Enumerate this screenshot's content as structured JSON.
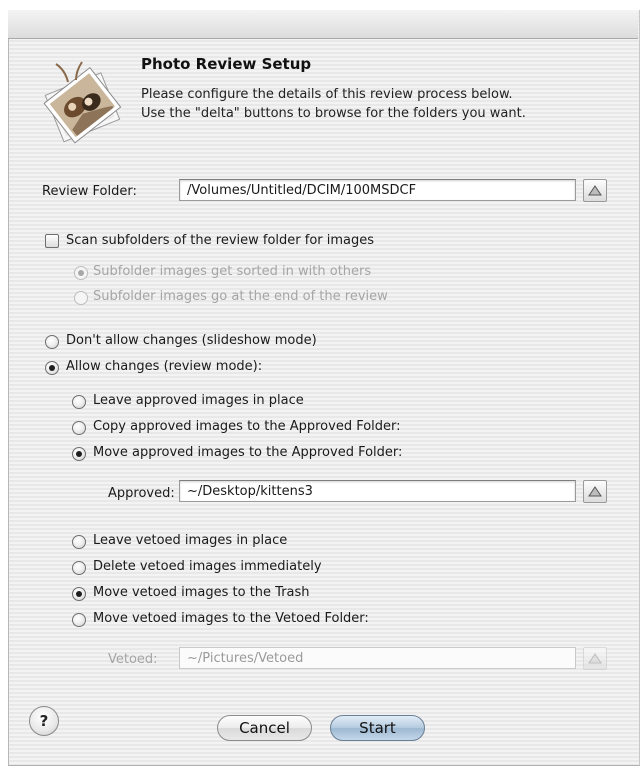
{
  "header": {
    "title": "Photo Review Setup",
    "description_line1": "Please configure the details of this review process below.",
    "description_line2": "Use the \"delta\" buttons to browse for the folders you want."
  },
  "review_folder": {
    "label": "Review Folder:",
    "value": "/Volumes/Untitled/DCIM/100MSDCF"
  },
  "scan_subfolders": {
    "label": "Scan subfolders of the review folder for images",
    "checked": false,
    "options": [
      "Subfolder images get sorted in with others",
      "Subfolder images go at the end of the review"
    ]
  },
  "mode": {
    "slideshow_label": "Don't allow changes (slideshow mode)",
    "review_label": "Allow changes (review mode):",
    "selected": "review"
  },
  "approved": {
    "options": [
      "Leave approved images in place",
      "Copy approved images to the Approved Folder:",
      "Move approved images to the Approved Folder:"
    ],
    "selected_index": 2,
    "folder_label": "Approved:",
    "folder_value": "~/Desktop/kittens3"
  },
  "vetoed": {
    "options": [
      "Leave vetoed images in place",
      "Delete vetoed images immediately",
      "Move vetoed images to the Trash",
      "Move vetoed images to the Vetoed Folder:"
    ],
    "selected_index": 2,
    "folder_label": "Vetoed:",
    "folder_value": "~/Pictures/Vetoed"
  },
  "buttons": {
    "help": "?",
    "cancel": "Cancel",
    "start": "Start"
  },
  "icons": {
    "app": "photo-stack-icon",
    "delta": "triangle-up-icon"
  }
}
